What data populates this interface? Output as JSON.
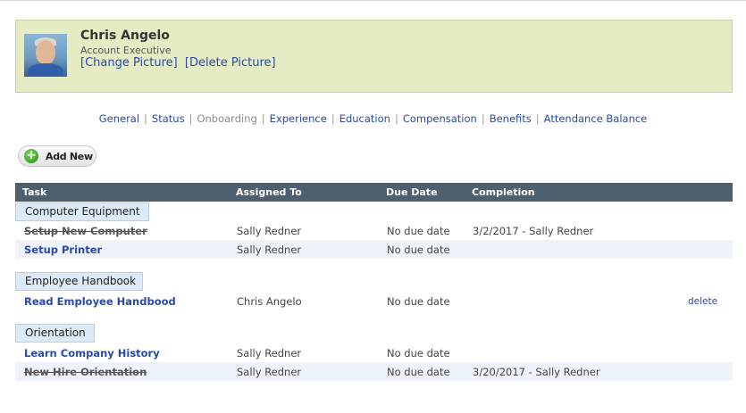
{
  "profile": {
    "name": "Chris Angelo",
    "title": "Account Executive",
    "change_picture": "[Change Picture]",
    "delete_picture": "[Delete Picture]"
  },
  "nav": {
    "items": [
      {
        "label": "General",
        "current": false
      },
      {
        "label": "Status",
        "current": false
      },
      {
        "label": "Onboarding",
        "current": true
      },
      {
        "label": "Experience",
        "current": false
      },
      {
        "label": "Education",
        "current": false
      },
      {
        "label": "Compensation",
        "current": false
      },
      {
        "label": "Benefits",
        "current": false
      },
      {
        "label": "Attendance Balance",
        "current": false
      }
    ],
    "separator": "|"
  },
  "toolbar": {
    "add_new": "Add New"
  },
  "table": {
    "headers": {
      "task": "Task",
      "assigned": "Assigned To",
      "due": "Due Date",
      "completion": "Completion"
    },
    "groups": [
      {
        "name": "Computer Equipment",
        "rows": [
          {
            "task": "Setup New Computer",
            "assigned": "Sally Redner",
            "due": "No due date",
            "completion": "3/2/2017 - Sally Redner",
            "done": true
          },
          {
            "task": "Setup Printer",
            "assigned": "Sally Redner",
            "due": "No due date",
            "completion": "",
            "done": false
          }
        ]
      },
      {
        "name": "Employee Handbook",
        "rows": [
          {
            "task": "Read Employee Handbood",
            "assigned": "Chris Angelo",
            "due": "No due date",
            "completion": "",
            "done": false,
            "action": "delete"
          }
        ]
      },
      {
        "name": "Orientation",
        "rows": [
          {
            "task": "Learn Company History",
            "assigned": "Sally Redner",
            "due": "No due date",
            "completion": "",
            "done": false
          },
          {
            "task": "New Hire Orientation",
            "assigned": "Sally Redner",
            "due": "No due date",
            "completion": "3/20/2017 - Sally Redner",
            "done": true
          }
        ]
      }
    ]
  }
}
